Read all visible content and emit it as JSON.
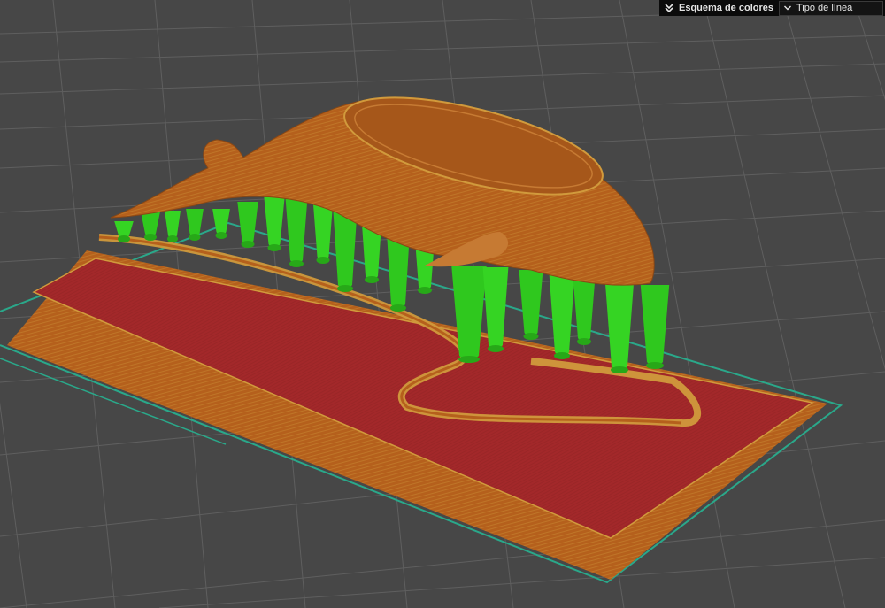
{
  "panel": {
    "title": "Esquema de colores",
    "collapse_icon": "double-chevron-down-icon",
    "dropdown_icon": "chevron-down-icon",
    "selected": "Tipo de línea"
  },
  "colors": {
    "background": "#474747",
    "grid": "#5f5f5f",
    "outer_wall": "#b5601c",
    "infill": "#a3282a",
    "support": "#2fc81e",
    "skirt": "#2aa88a",
    "inner_wall": "#d19a3c"
  }
}
